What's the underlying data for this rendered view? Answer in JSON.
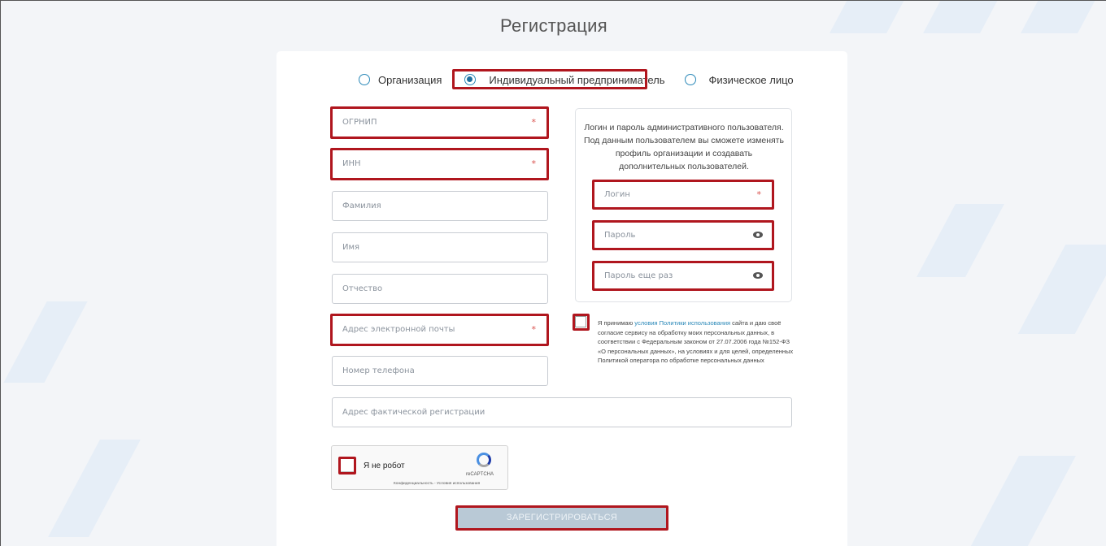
{
  "page": {
    "title": "Регистрация"
  },
  "account_type": {
    "options": [
      {
        "label": "Организация",
        "checked": false
      },
      {
        "label": "Индивидуальный предприниматель",
        "checked": true
      },
      {
        "label": "Физическое лицо",
        "checked": false
      }
    ]
  },
  "form": {
    "ogrnip": {
      "placeholder": "ОГРНИП",
      "required_mark": "*"
    },
    "inn": {
      "placeholder": "ИНН",
      "required_mark": "*"
    },
    "last_name": {
      "placeholder": "Фамилия"
    },
    "first_name": {
      "placeholder": "Имя"
    },
    "middle_name": {
      "placeholder": "Отчество"
    },
    "email": {
      "placeholder": "Адрес электронной почты",
      "required_mark": "*"
    },
    "phone": {
      "placeholder": "Номер телефона"
    },
    "address": {
      "placeholder": "Адрес фактической регистрации"
    }
  },
  "admin": {
    "info_text": "Логин и пароль административного пользователя. Под данным пользователем вы сможете изменять профиль организации и создавать дополнительных пользователей.",
    "login": {
      "placeholder": "Логин",
      "required_mark": "*"
    },
    "password": {
      "placeholder": "Пароль"
    },
    "password_repeat": {
      "placeholder": "Пароль еще раз"
    }
  },
  "consent": {
    "prefix": "Я принимаю ",
    "link": "условия Политики использования",
    "suffix": " сайта и даю своё согласие сервису на обработку моих персональных данных, в соответствии с Федеральным законом от 27.07.2006 года №152-ФЗ «О персональных данных», на условиях и для целей, определенных Политикой оператора по обработке персональных данных"
  },
  "captcha": {
    "label": "Я не робот",
    "brand": "reCAPTCHA",
    "links": "Конфиденциальность - Условия использования"
  },
  "submit": {
    "label": "ЗАРЕГИСТРИРОВАТЬСЯ"
  },
  "colors": {
    "highlight": "#b0161e",
    "accent": "#2a88b8",
    "required": "#d9534f",
    "button": "#b9c9d6"
  }
}
